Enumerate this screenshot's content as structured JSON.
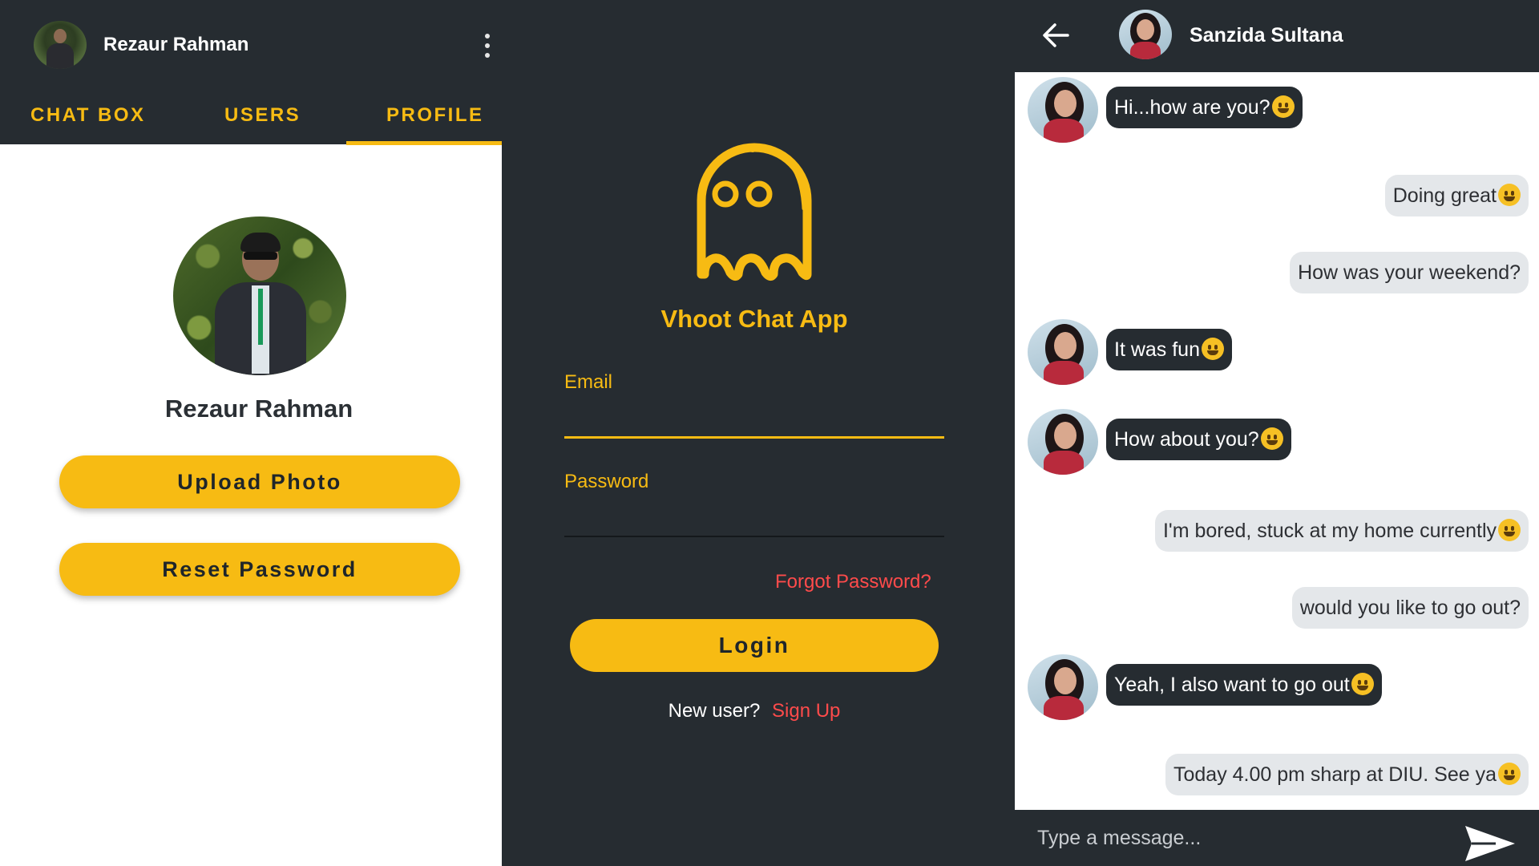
{
  "colors": {
    "dark": "#262c31",
    "accent": "#f7bb13",
    "link_red": "#ff4b4b",
    "out_bubble": "#e4e7ea",
    "white": "#ffffff"
  },
  "profile_screen": {
    "header": {
      "name": "Rezaur Rahman",
      "menu_icon": "more-vert-icon"
    },
    "tabs": [
      {
        "label": "CHAT BOX",
        "selected": false
      },
      {
        "label": "USERS",
        "selected": false
      },
      {
        "label": "PROFILE",
        "selected": true
      }
    ],
    "profile_name": "Rezaur Rahman",
    "upload_photo_label": "Upload Photo",
    "reset_password_label": "Reset Password"
  },
  "login_screen": {
    "logo_icon": "ghost-icon",
    "app_title": "Vhoot Chat App",
    "email_label": "Email",
    "email_value": "",
    "password_label": "Password",
    "password_value": "",
    "forgot_password": "Forgot Password?",
    "login_label": "Login",
    "new_user_prompt": "New user?",
    "sign_up": "Sign Up"
  },
  "chat_screen": {
    "header": {
      "back_icon": "arrow-back-icon",
      "contact_name": "Sanzida Sultana"
    },
    "messages": [
      {
        "direction": "in",
        "text": "Hi...how are you?",
        "emoji": "smiley-emoji"
      },
      {
        "direction": "out",
        "text": "Doing great",
        "emoji": "wink-emoji"
      },
      {
        "direction": "out",
        "text": "How was your weekend?",
        "emoji": ""
      },
      {
        "direction": "in",
        "text": "It was fun",
        "emoji": "grin-emoji"
      },
      {
        "direction": "in",
        "text": "How about you?",
        "emoji": "thinking-emoji"
      },
      {
        "direction": "out",
        "text": "I'm bored, stuck at my home currently",
        "emoji": "unamused-emoji"
      },
      {
        "direction": "out",
        "text": "would you like to go out?",
        "emoji": ""
      },
      {
        "direction": "in",
        "text": "Yeah, I also want to go out",
        "emoji": "smiley-emoji"
      },
      {
        "direction": "out",
        "text": "Today 4.00 pm sharp at DIU. See ya",
        "emoji": "kiss-emoji"
      }
    ],
    "composer": {
      "placeholder": "Type a message...",
      "send_icon": "send-icon"
    }
  }
}
